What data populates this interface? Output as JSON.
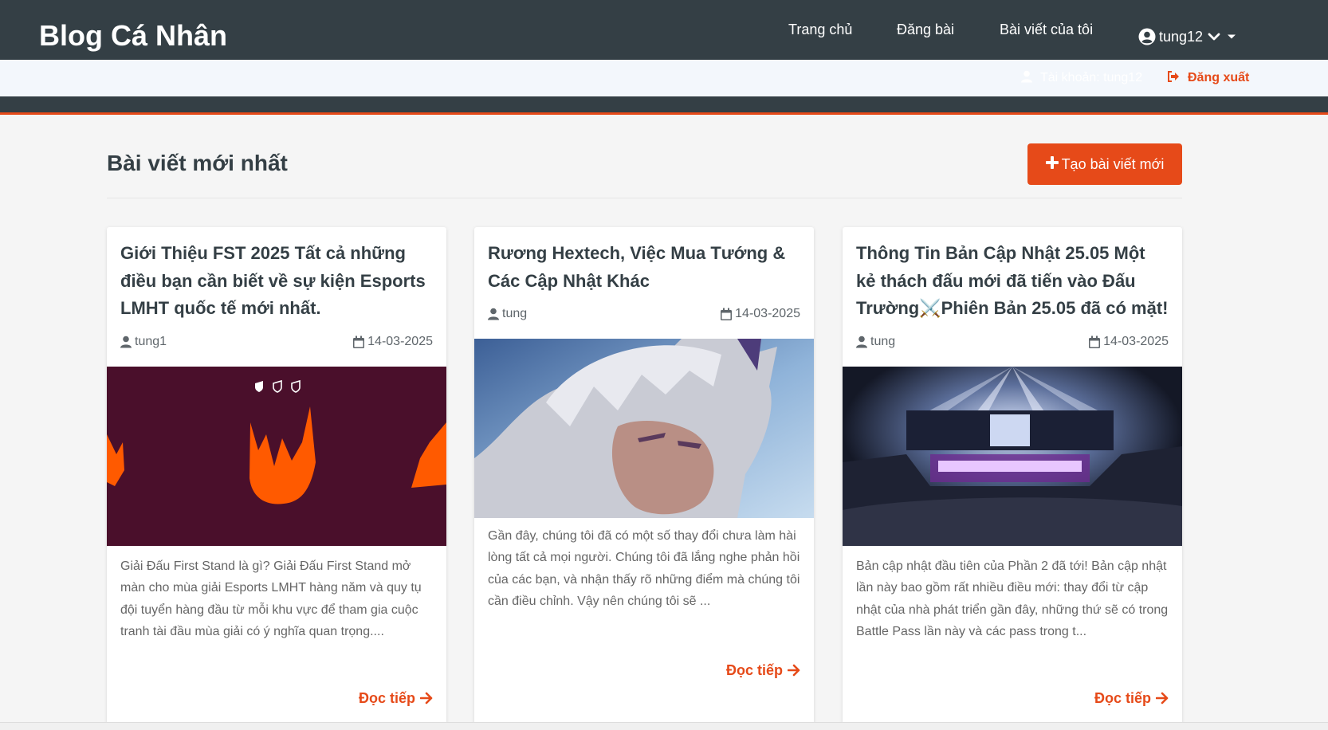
{
  "navbar": {
    "brand": "Blog Cá Nhân",
    "links": [
      "Trang chủ",
      "Đăng bài",
      "Bài viết của tôi"
    ],
    "username": "tung12"
  },
  "dropdown": {
    "account_label": "Tài khoản: tung12",
    "logout_label": "Đăng xuất"
  },
  "section": {
    "title": "Bài viết mới nhất",
    "create_label": "Tạo bài viết mới"
  },
  "posts": [
    {
      "title": "Giới Thiệu FST 2025 Tất cả những điều bạn cần biết về sự kiện Esports LMHT quốc tế mới nhất.",
      "author": "tung1",
      "date": "14-03-2025",
      "excerpt": "Giải Đấu First Stand là gì? Giải Đấu First Stand mở màn cho mùa giải Esports LMHT hàng năm và quy tụ đội tuyển hàng đầu từ mỗi khu vực để tham gia cuộc tranh tài đầu mùa giải có ý nghĩa quan trọng....",
      "read_more": "Đọc tiếp"
    },
    {
      "title": "Rương Hextech, Việc Mua Tướng & Các Cập Nhật Khác",
      "author": "tung",
      "date": "14-03-2025",
      "excerpt": "Gần đây, chúng tôi đã có một số thay đổi chưa làm hài lòng tất cả mọi người. Chúng tôi đã lắng nghe phản hồi của các bạn, và nhận thấy rõ những điểm mà chúng tôi cần điều chỉnh. Vậy nên chúng tôi sẽ ...",
      "read_more": "Đọc tiếp"
    },
    {
      "title": "Thông Tin Bản Cập Nhật 25.05 Một kẻ thách đấu mới đã tiến vào Đấu Trường⚔️Phiên Bản 25.05 đã có mặt!",
      "author": "tung",
      "date": "14-03-2025",
      "excerpt": "Bản cập nhật đầu tiên của Phần 2 đã tới! Bản cập nhật lần này bao gồm rất nhiều điều mới: thay đổi từ cập nhật của nhà phát triển gần đây, những thứ sẽ có trong Battle Pass lần này và các pass trong t...",
      "read_more": "Đọc tiếp"
    }
  ],
  "colors": {
    "nav_bg": "#343f45",
    "accent": "#e64a19",
    "page_bg": "#f5f5f5"
  },
  "icons": [
    "user-circle-icon",
    "chevron-down-icon",
    "caret-down-icon",
    "user-icon",
    "sign-out-icon",
    "plus-icon",
    "calendar-icon",
    "arrow-right-icon"
  ]
}
